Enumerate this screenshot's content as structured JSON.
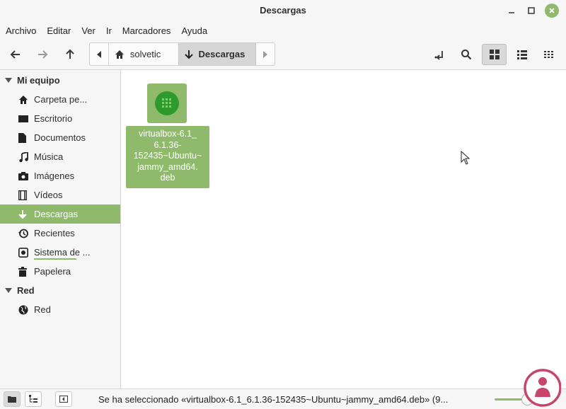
{
  "window": {
    "title": "Descargas"
  },
  "menu": [
    "Archivo",
    "Editar",
    "Ver",
    "Ir",
    "Marcadores",
    "Ayuda"
  ],
  "pathbar": {
    "home": "solvetic",
    "current": "Descargas"
  },
  "sidebar": {
    "sections": [
      {
        "label": "Mi equipo"
      },
      {
        "label": "Red"
      }
    ],
    "items": [
      {
        "label": "Carpeta pe...",
        "icon": "home-icon"
      },
      {
        "label": "Escritorio",
        "icon": "desktop-icon"
      },
      {
        "label": "Documentos",
        "icon": "document-icon"
      },
      {
        "label": "Música",
        "icon": "music-icon"
      },
      {
        "label": "Imágenes",
        "icon": "camera-icon"
      },
      {
        "label": "Vídeos",
        "icon": "film-icon"
      },
      {
        "label": "Descargas",
        "icon": "download-icon",
        "selected": true
      },
      {
        "label": "Recientes",
        "icon": "history-icon"
      },
      {
        "label": "Sistema de ...",
        "icon": "drive-icon",
        "usage": 0.6
      },
      {
        "label": "Papelera",
        "icon": "trash-icon"
      },
      {
        "label": "Red",
        "icon": "globe-icon"
      }
    ]
  },
  "files": [
    {
      "name": "virtualbox-6.1_ 6.1.36- 152435~Ubuntu~ jammy_amd64. deb",
      "icon": "deb-package-icon",
      "selected": true
    }
  ],
  "status": {
    "text": "Se ha seleccionado «virtualbox-6.1_6.1.36-152435~Ubuntu~jammy_amd64.deb» (9...",
    "zoom_level": 0.7
  },
  "colors": {
    "accent": "#8fba6c",
    "package_green": "#2e9a2e"
  }
}
